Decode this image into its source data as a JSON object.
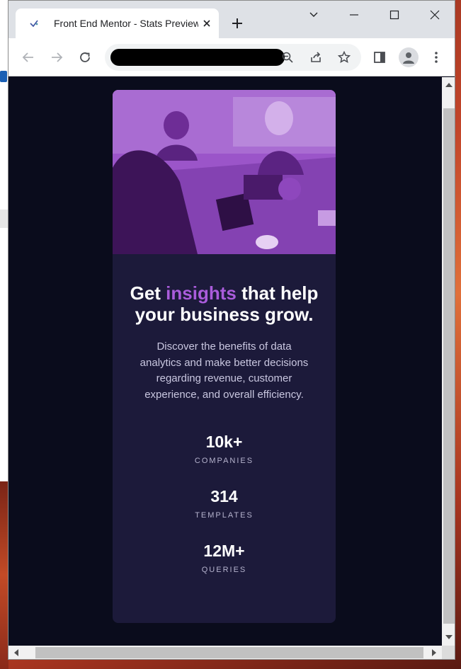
{
  "browser": {
    "tab_title": "Front End Mentor - Stats Preview",
    "url": ""
  },
  "card": {
    "headline_before": "Get ",
    "headline_accent": "insights",
    "headline_after": " that help your business grow.",
    "description": "Discover the benefits of data analytics and make better decisions regarding revenue, customer experience, and overall efficiency.",
    "stats": [
      {
        "value": "10k+",
        "label": "COMPANIES"
      },
      {
        "value": "314",
        "label": "TEMPLATES"
      },
      {
        "value": "12M+",
        "label": "QUERIES"
      }
    ]
  },
  "colors": {
    "page_bg": "#0a0c1c",
    "card_bg": "#1c1a3a",
    "accent": "#aa5cdb",
    "text": "#ffffff",
    "muted_text": "#c9c7e0"
  },
  "icons": {
    "back": "arrow-left-icon",
    "forward": "arrow-right-icon",
    "reload": "reload-icon",
    "zoom": "zoom-icon",
    "share": "share-icon",
    "bookmark": "star-icon",
    "sidepanel": "side-panel-icon",
    "profile": "profile-icon",
    "menu": "kebab-menu-icon"
  }
}
